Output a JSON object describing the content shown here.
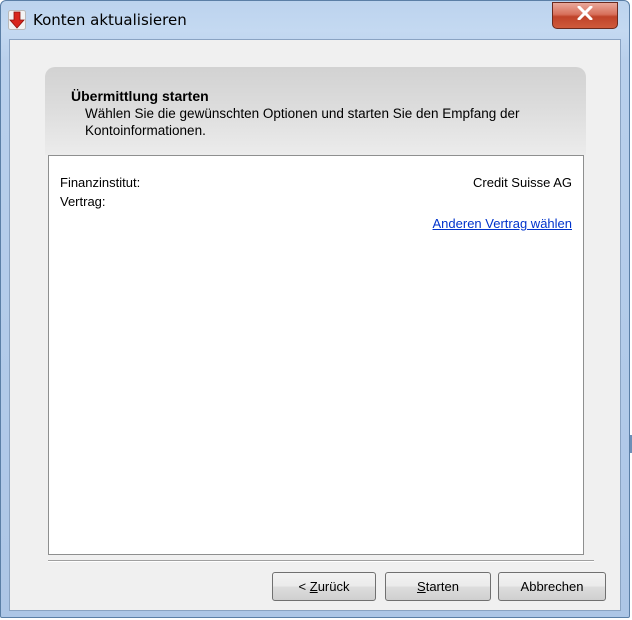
{
  "window": {
    "title": "Konten aktualisieren",
    "close_symbol": "X"
  },
  "icons": {
    "app": "red-down-arrow-icon",
    "close": "close-icon"
  },
  "colors": {
    "title_gradient_top": "#bcd3ee",
    "close_red": "#c0432a",
    "link_blue": "#0033cc",
    "panel_bg": "#f0f0f0"
  },
  "header": {
    "title": "Übermittlung starten",
    "description_line1": "Wählen Sie die gewünschten Optionen und starten Sie den Empfang der",
    "description_line2": "Kontoinformationen."
  },
  "content": {
    "institution_label": "Finanzinstitut:",
    "institution_value": "Credit Suisse AG",
    "contract_label": "Vertrag:",
    "contract_value": "",
    "change_contract_link": "Anderen Vertrag wählen"
  },
  "buttons": {
    "back_prefix": "< ",
    "back_mnemonic": "Z",
    "back_rest": "urück",
    "start_mnemonic": "S",
    "start_rest": "tarten",
    "cancel": "Abbrechen"
  }
}
